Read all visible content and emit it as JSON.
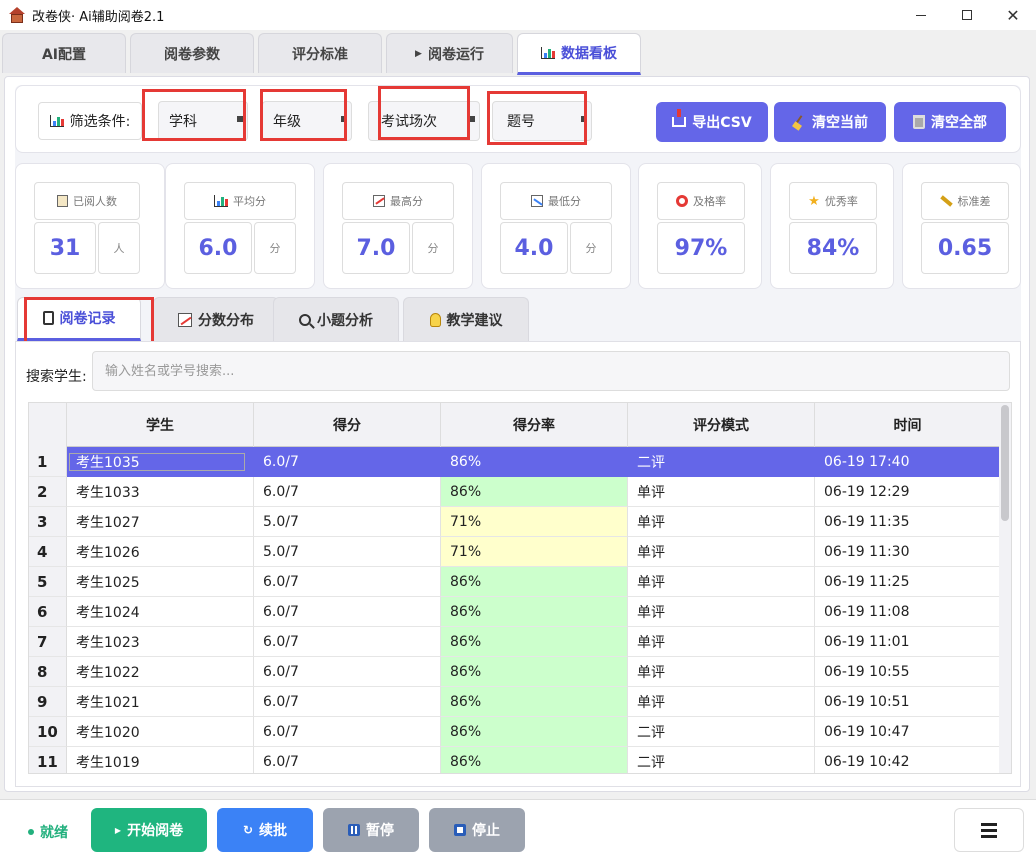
{
  "window": {
    "title": "改卷侠· Ai辅助阅卷2.1",
    "minimize": "—",
    "maximize": "□",
    "close": "✕"
  },
  "tabs": [
    {
      "label": "AI配置",
      "icon": ""
    },
    {
      "label": "阅卷参数",
      "icon": ""
    },
    {
      "label": "评分标准",
      "icon": ""
    },
    {
      "label": "阅卷运行",
      "icon": "play-icon"
    },
    {
      "label": "数据看板",
      "icon": "bar-chart-icon"
    }
  ],
  "active_tab": "数据看板",
  "filter": {
    "label": "筛选条件:",
    "subject": "学科",
    "grade": "年级",
    "exam": "考试场次",
    "question": "题号"
  },
  "actions": {
    "export": "导出CSV",
    "clear_current": "清空当前",
    "clear_all": "清空全部"
  },
  "stats": {
    "reviewed": {
      "label": "已阅人数",
      "value": "31",
      "unit": "人"
    },
    "average": {
      "label": "平均分",
      "value": "6.0",
      "unit": "分"
    },
    "max": {
      "label": "最高分",
      "value": "7.0",
      "unit": "分"
    },
    "min": {
      "label": "最低分",
      "value": "4.0",
      "unit": "分"
    },
    "pass_rate": {
      "label": "及格率",
      "value": "97%"
    },
    "excellent_rate": {
      "label": "优秀率",
      "value": "84%"
    },
    "std_dev": {
      "label": "标准差",
      "value": "0.65"
    }
  },
  "subtabs": [
    "阅卷记录",
    "分数分布",
    "小题分析",
    "教学建议"
  ],
  "search": {
    "label": "搜索学生:",
    "placeholder": "输入姓名或学号搜索..."
  },
  "table": {
    "columns": [
      "学生",
      "得分",
      "得分率",
      "评分模式",
      "时间"
    ],
    "rows": [
      {
        "n": "1",
        "student": "考生1035",
        "score": "6.0/7",
        "rate": "86%",
        "mode": "二评",
        "time": "06-19 17:40"
      },
      {
        "n": "2",
        "student": "考生1033",
        "score": "6.0/7",
        "rate": "86%",
        "mode": "单评",
        "time": "06-19 12:29"
      },
      {
        "n": "3",
        "student": "考生1027",
        "score": "5.0/7",
        "rate": "71%",
        "mode": "单评",
        "time": "06-19 11:35"
      },
      {
        "n": "4",
        "student": "考生1026",
        "score": "5.0/7",
        "rate": "71%",
        "mode": "单评",
        "time": "06-19 11:30"
      },
      {
        "n": "5",
        "student": "考生1025",
        "score": "6.0/7",
        "rate": "86%",
        "mode": "单评",
        "time": "06-19 11:25"
      },
      {
        "n": "6",
        "student": "考生1024",
        "score": "6.0/7",
        "rate": "86%",
        "mode": "单评",
        "time": "06-19 11:08"
      },
      {
        "n": "7",
        "student": "考生1023",
        "score": "6.0/7",
        "rate": "86%",
        "mode": "单评",
        "time": "06-19 11:01"
      },
      {
        "n": "8",
        "student": "考生1022",
        "score": "6.0/7",
        "rate": "86%",
        "mode": "单评",
        "time": "06-19 10:55"
      },
      {
        "n": "9",
        "student": "考生1021",
        "score": "6.0/7",
        "rate": "86%",
        "mode": "单评",
        "time": "06-19 10:51"
      },
      {
        "n": "10",
        "student": "考生1020",
        "score": "6.0/7",
        "rate": "86%",
        "mode": "二评",
        "time": "06-19 10:47"
      },
      {
        "n": "11",
        "student": "考生1019",
        "score": "6.0/7",
        "rate": "86%",
        "mode": "二评",
        "time": "06-19 10:42"
      }
    ]
  },
  "colors": {
    "accent": "#6466e8",
    "rate_high": "#ccffcc",
    "rate_mid": "#ffffcc",
    "start_button": "#1fb57f",
    "resume_button": "#3b82f6",
    "disabled_button": "#9ca3af"
  },
  "bottom": {
    "status": "就绪",
    "start": "开始阅卷",
    "resume": "续批",
    "pause": "暂停",
    "stop": "停止"
  }
}
